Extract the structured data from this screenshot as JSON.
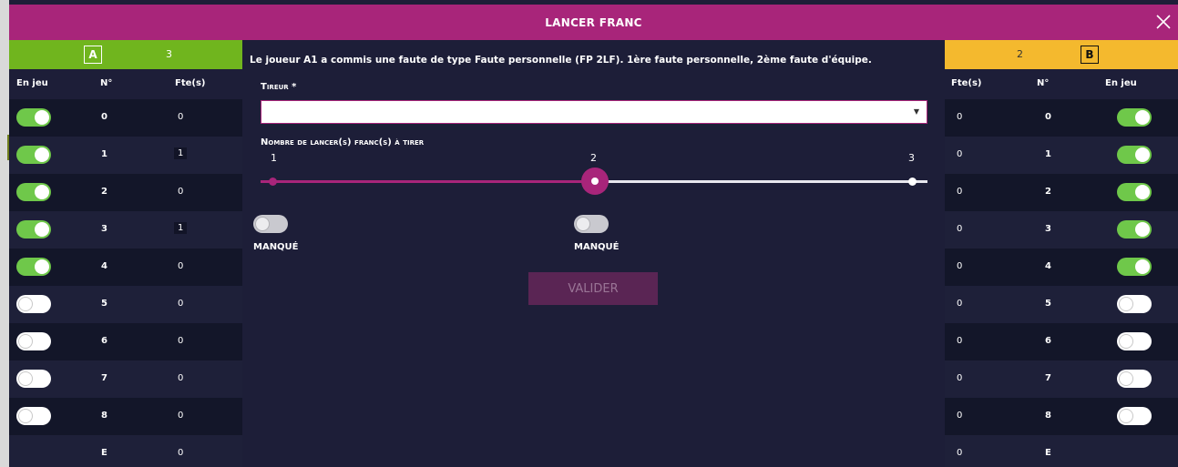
{
  "header": {
    "title": "LANCER FRANC"
  },
  "teams": {
    "a": {
      "letter": "A",
      "score": "3",
      "headers": {
        "en_jeu": "En jeu",
        "no": "N°",
        "fte": "Fte(s)"
      },
      "players": [
        {
          "no": "0",
          "fte": "0",
          "on_court": true
        },
        {
          "no": "1",
          "fte": "1",
          "on_court": true
        },
        {
          "no": "2",
          "fte": "0",
          "on_court": true
        },
        {
          "no": "3",
          "fte": "1",
          "on_court": true
        },
        {
          "no": "4",
          "fte": "0",
          "on_court": true
        },
        {
          "no": "5",
          "fte": "0",
          "on_court": false
        },
        {
          "no": "6",
          "fte": "0",
          "on_court": false
        },
        {
          "no": "7",
          "fte": "0",
          "on_court": false
        },
        {
          "no": "8",
          "fte": "0",
          "on_court": false
        },
        {
          "no": "E",
          "fte": "0",
          "on_court": null
        }
      ]
    },
    "b": {
      "letter": "B",
      "score": "2",
      "headers": {
        "fte": "Fte(s)",
        "no": "N°",
        "en_jeu": "En jeu"
      },
      "players": [
        {
          "no": "0",
          "fte": "0",
          "on_court": true
        },
        {
          "no": "1",
          "fte": "0",
          "on_court": true
        },
        {
          "no": "2",
          "fte": "0",
          "on_court": true
        },
        {
          "no": "3",
          "fte": "0",
          "on_court": true
        },
        {
          "no": "4",
          "fte": "0",
          "on_court": true
        },
        {
          "no": "5",
          "fte": "0",
          "on_court": false
        },
        {
          "no": "6",
          "fte": "0",
          "on_court": false
        },
        {
          "no": "7",
          "fte": "0",
          "on_court": false
        },
        {
          "no": "8",
          "fte": "0",
          "on_court": false
        },
        {
          "no": "E",
          "fte": "0",
          "on_court": null
        }
      ]
    }
  },
  "center": {
    "info": "Le joueur A1 a commis une faute de type Faute personnelle (FP 2LF). 1ère faute personnelle, 2ème faute d'équipe.",
    "tireur_label": "Tireur *",
    "tireur_value": "",
    "nombre_label": "Nombre de lancer(s) franc(s) à tirer",
    "slider": {
      "min": 1,
      "max": 3,
      "value": 2,
      "ticks": [
        "1",
        "2",
        "3"
      ]
    },
    "missed_label": "MANQUÉ",
    "missed_values": [
      false,
      false
    ],
    "valider_label": "VALIDER"
  },
  "colors": {
    "header": "#a8257a",
    "team_a": "#70b51e",
    "team_b": "#f4b92e",
    "background": "#1d1e38",
    "toggle_on": "#6fc84a"
  }
}
